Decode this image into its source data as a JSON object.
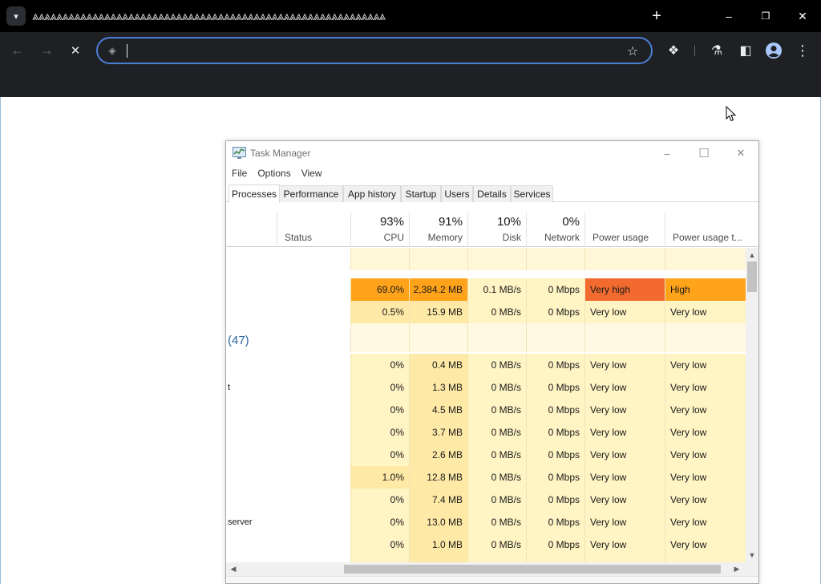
{
  "browser": {
    "tab_title": "⩓⩓⩓⩓⩓⩓⩓⩓⩓⩓⩓⩓⩓⩓⩓⩓⩓⩓⩓⩓⩓⩓⩓⩓⩓⩓⩓⩓⩓⩓⩓⩓⩓⩓⩓⩓⩓⩓⩓⩓⩓⩓⩓⩓⩓⩓⩓⩓⩓⩓⩓⩓⩓⩓⩓⩓⩓⩓⩓",
    "new_tab_glyph": "+",
    "omnibox_value": "",
    "colors": {
      "tabstrip": "#000000",
      "toolbar": "#1f2023",
      "omnibox_focus": "#4a7fd8"
    }
  },
  "icons": {
    "tab_search": "▾",
    "minimize": "–",
    "restore": "❐",
    "close": "✕",
    "back": "←",
    "forward": "→",
    "stop": "✕",
    "site_info": "◈",
    "star": "☆",
    "extensions": "❖",
    "labs": "⚗",
    "side_panel": "◧",
    "profile": "●",
    "menu": "⋮",
    "tm_minimize": "–",
    "tm_maximize": "☐",
    "tm_close": "✕",
    "arrow_up": "▲",
    "arrow_down": "▼",
    "arrow_left": "◀",
    "arrow_right": "▶"
  },
  "task_manager": {
    "title": "Task Manager",
    "menu": [
      "File",
      "Options",
      "View"
    ],
    "tabs": [
      "Processes",
      "Performance",
      "App history",
      "Startup",
      "Users",
      "Details",
      "Services"
    ],
    "active_tab": "Processes",
    "headers": {
      "status": "Status",
      "cpu_pct": "93%",
      "cpu": "CPU",
      "memory_pct": "91%",
      "memory": "Memory",
      "disk_pct": "10%",
      "disk": "Disk",
      "network_pct": "0%",
      "network": "Network",
      "power": "Power usage",
      "power_trend": "Power usage t..."
    },
    "group_label": "(47)",
    "rows": [
      {
        "name": "",
        "cpu": "",
        "memory": "",
        "disk": "",
        "network": "",
        "power": "",
        "trend": "",
        "kind": "blank"
      },
      {
        "name": "",
        "cpu": "69.0%",
        "memory": "2,384.2 MB",
        "disk": "0.1 MB/s",
        "network": "0 Mbps",
        "power": "Very high",
        "trend": "High",
        "kind": "hot"
      },
      {
        "name": "",
        "cpu": "0.5%",
        "memory": "15.9 MB",
        "disk": "0 MB/s",
        "network": "0 Mbps",
        "power": "Very low",
        "trend": "Very low",
        "kind": "normal"
      },
      {
        "name": "",
        "cpu": "",
        "memory": "",
        "disk": "",
        "network": "",
        "power": "",
        "trend": "",
        "kind": "group"
      },
      {
        "name": "",
        "cpu": "0%",
        "memory": "0.4 MB",
        "disk": "0 MB/s",
        "network": "0 Mbps",
        "power": "Very low",
        "trend": "Very low",
        "kind": "normal"
      },
      {
        "name": "t",
        "cpu": "0%",
        "memory": "1.3 MB",
        "disk": "0 MB/s",
        "network": "0 Mbps",
        "power": "Very low",
        "trend": "Very low",
        "kind": "normal"
      },
      {
        "name": "",
        "cpu": "0%",
        "memory": "4.5 MB",
        "disk": "0 MB/s",
        "network": "0 Mbps",
        "power": "Very low",
        "trend": "Very low",
        "kind": "normal"
      },
      {
        "name": "",
        "cpu": "0%",
        "memory": "3.7 MB",
        "disk": "0 MB/s",
        "network": "0 Mbps",
        "power": "Very low",
        "trend": "Very low",
        "kind": "normal"
      },
      {
        "name": "",
        "cpu": "0%",
        "memory": "2.6 MB",
        "disk": "0 MB/s",
        "network": "0 Mbps",
        "power": "Very low",
        "trend": "Very low",
        "kind": "normal"
      },
      {
        "name": "",
        "cpu": "1.0%",
        "memory": "12.8 MB",
        "disk": "0 MB/s",
        "network": "0 Mbps",
        "power": "Very low",
        "trend": "Very low",
        "kind": "normal"
      },
      {
        "name": "",
        "cpu": "0%",
        "memory": "7.4 MB",
        "disk": "0 MB/s",
        "network": "0 Mbps",
        "power": "Very low",
        "trend": "Very low",
        "kind": "normal"
      },
      {
        "name": "server",
        "cpu": "0%",
        "memory": "13.0 MB",
        "disk": "0 MB/s",
        "network": "0 Mbps",
        "power": "Very low",
        "trend": "Very low",
        "kind": "normal"
      },
      {
        "name": "",
        "cpu": "0%",
        "memory": "1.0 MB",
        "disk": "0 MB/s",
        "network": "0 Mbps",
        "power": "Very low",
        "trend": "Very low",
        "kind": "normal"
      },
      {
        "name": "",
        "cpu": "",
        "memory": "",
        "disk": "",
        "network": "",
        "power": "",
        "trend": "",
        "kind": "normal"
      }
    ],
    "colors": {
      "cell_light": "#fff4c4",
      "cell_mid": "#ffe9a6",
      "cell_blank": "#fff7d8",
      "cell_hot": "#ffa31a",
      "cell_very_high": "#f26a2e",
      "cell_group": "#fff9e4",
      "group_text": "#2b63a4"
    }
  }
}
